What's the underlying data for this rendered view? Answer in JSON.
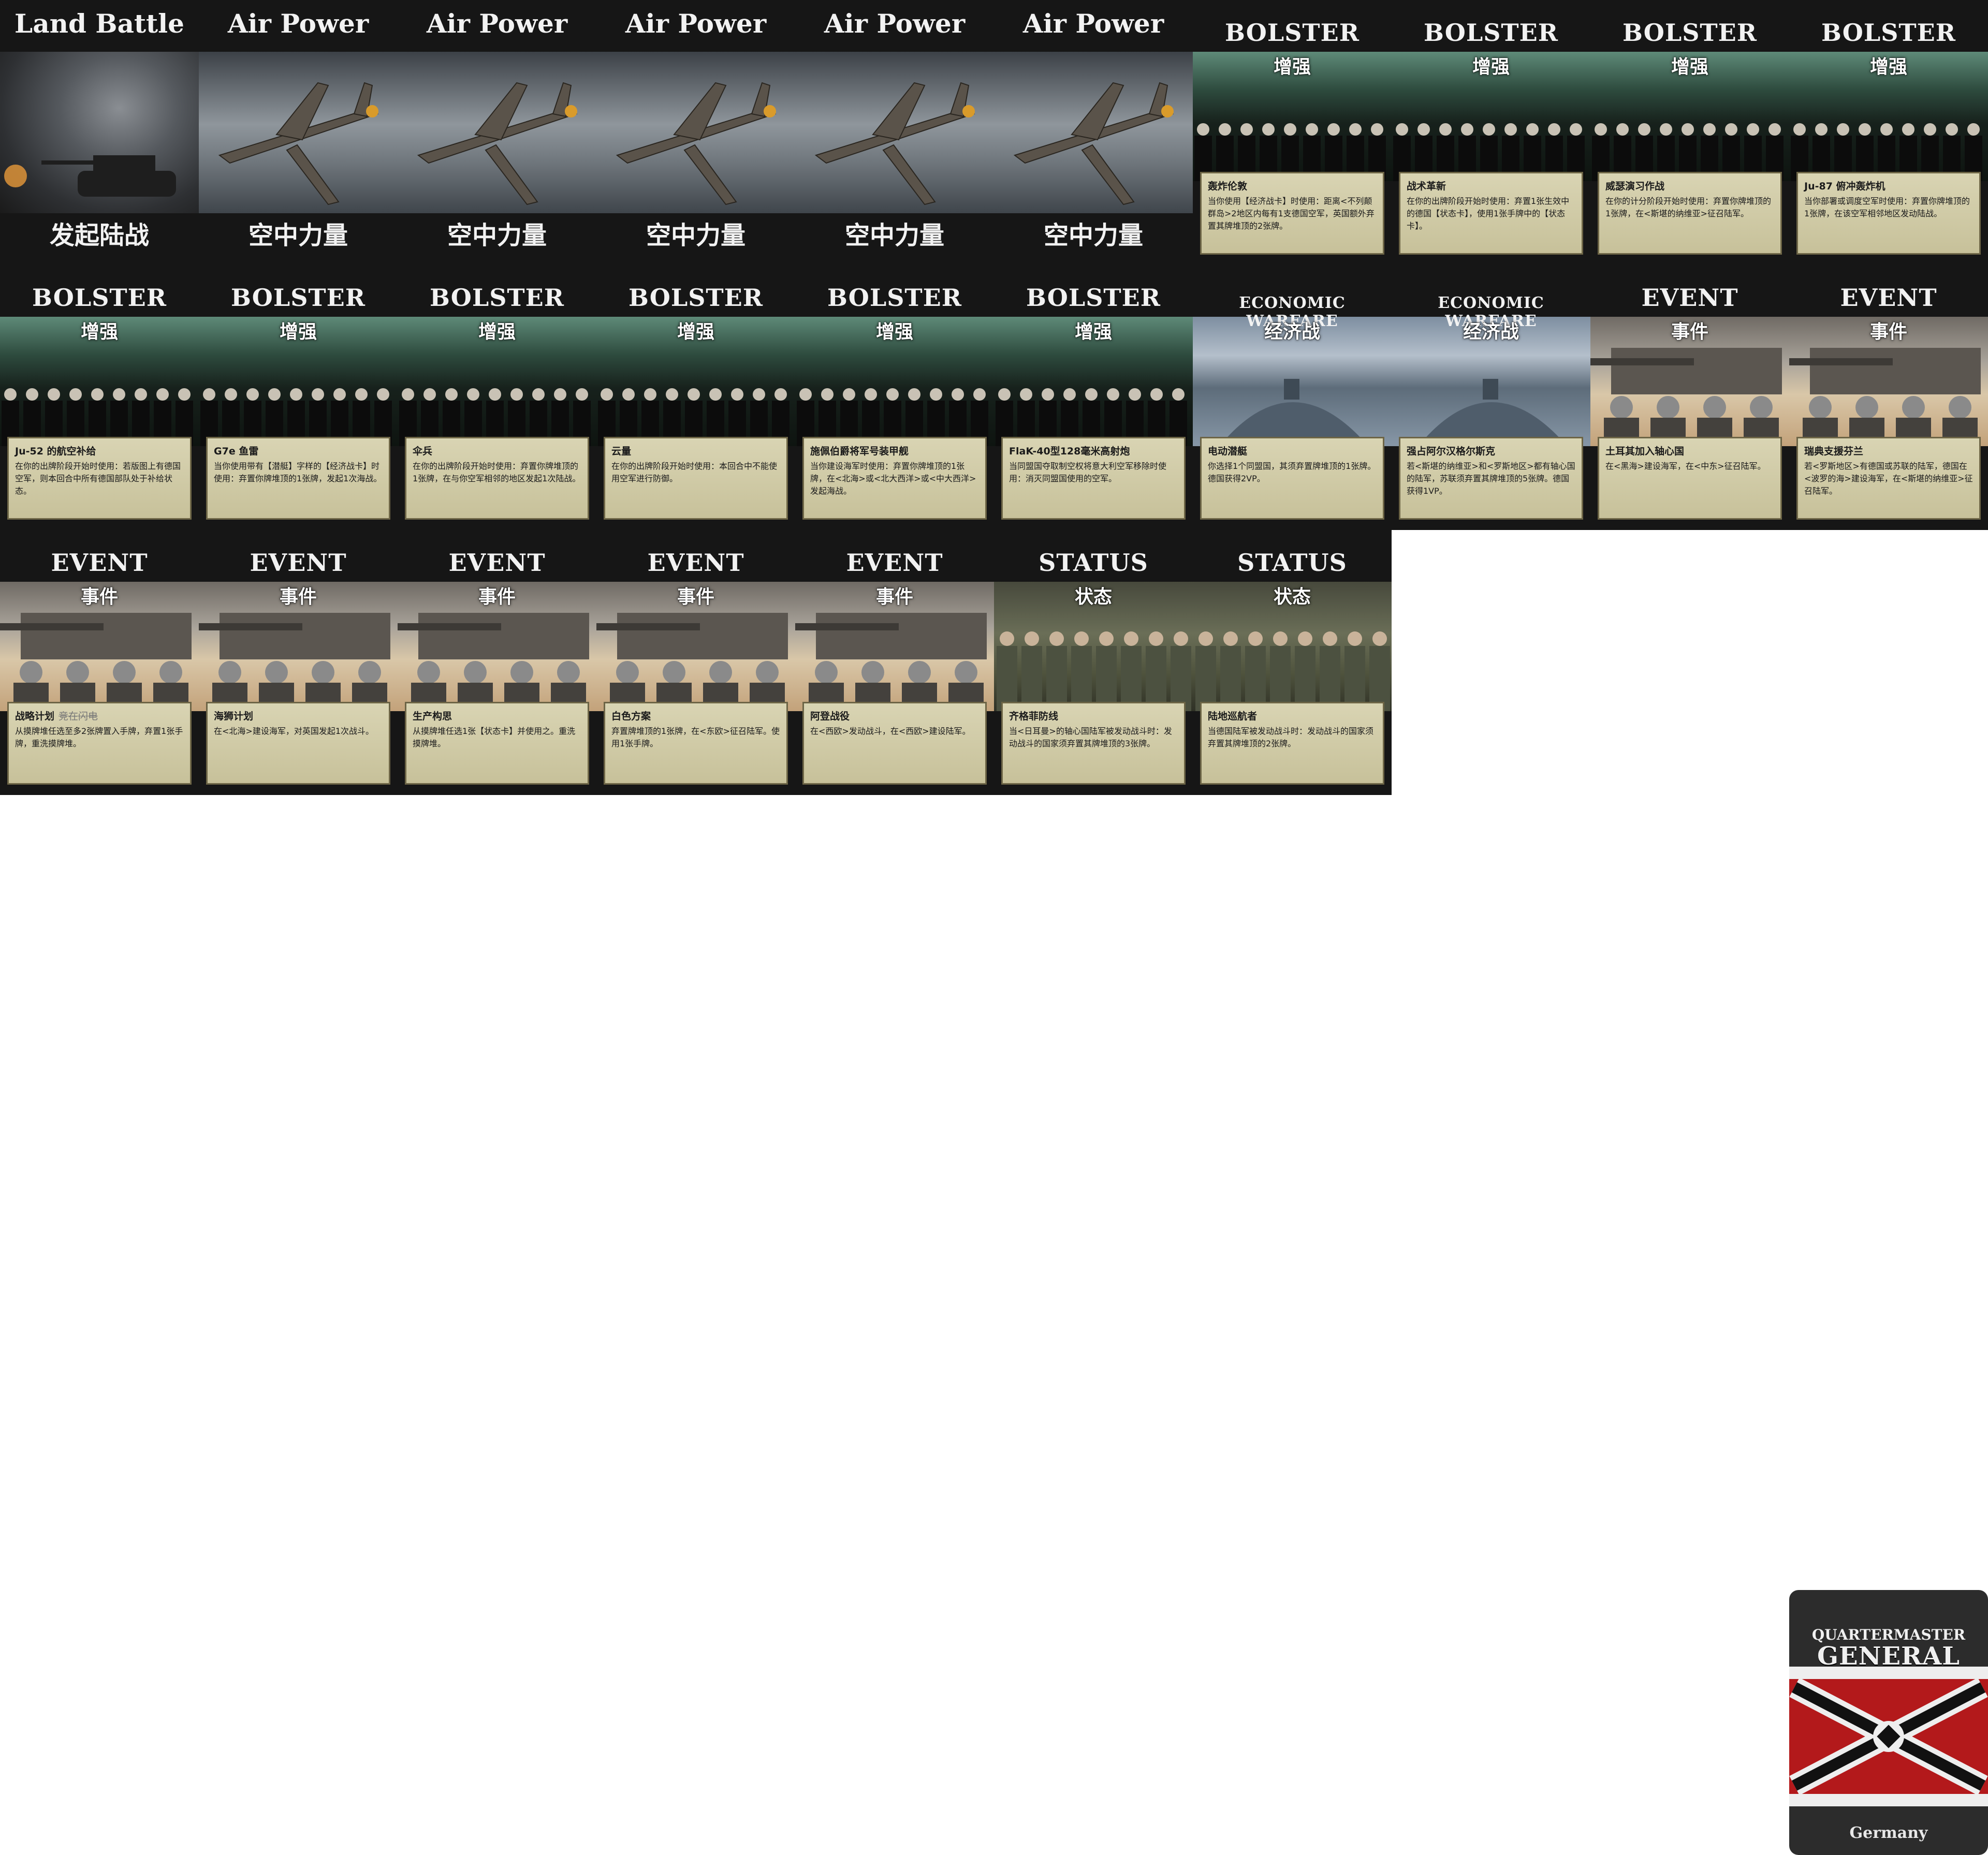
{
  "power_cards": [
    {
      "title_en": "Land Battle",
      "title_zh": "发起陆战",
      "art": "tank-icon"
    },
    {
      "title_en": "Air Power",
      "title_zh": "空中力量",
      "art": "fighter-plane-icon"
    },
    {
      "title_en": "Air Power",
      "title_zh": "空中力量",
      "art": "fighter-plane-icon"
    },
    {
      "title_en": "Air Power",
      "title_zh": "空中力量",
      "art": "fighter-plane-icon"
    },
    {
      "title_en": "Air Power",
      "title_zh": "空中力量",
      "art": "fighter-plane-icon"
    },
    {
      "title_en": "Air Power",
      "title_zh": "空中力量",
      "art": "fighter-plane-icon"
    }
  ],
  "rule_cards": [
    {
      "category_en": "BOLSTER",
      "category_zh": "增强",
      "name": "轰炸伦敦",
      "strike": "",
      "text": "当你使用【经济战卡】时使用：距离<不列颠群岛>2地区内每有1支德国空军，英国额外弃置其牌堆顶的2张牌。",
      "art": "bolster"
    },
    {
      "category_en": "BOLSTER",
      "category_zh": "增强",
      "name": "战术革新",
      "strike": "",
      "text": "在你的出牌阶段开始时使用：弃置1张生效中的德国【状态卡】，使用1张手牌中的【状态卡】。",
      "art": "bolster"
    },
    {
      "category_en": "BOLSTER",
      "category_zh": "增强",
      "name": "威瑟演习作战",
      "strike": "",
      "text": "在你的计分阶段开始时使用：弃置你牌堆顶的1张牌，在<斯堪的纳维亚>征召陆军。",
      "art": "bolster"
    },
    {
      "category_en": "BOLSTER",
      "category_zh": "增强",
      "name": "Ju-87 俯冲轰炸机",
      "strike": "",
      "text": "当你部署或调度空军时使用：弃置你牌堆顶的1张牌，在该空军相邻地区发动陆战。",
      "art": "bolster"
    },
    {
      "category_en": "BOLSTER",
      "category_zh": "增强",
      "name": "Ju-52 的航空补给",
      "strike": "",
      "text": "在你的出牌阶段开始时使用：若版图上有德国空军，则本回合中所有德国部队处于补给状态。",
      "art": "bolster"
    },
    {
      "category_en": "BOLSTER",
      "category_zh": "增强",
      "name": "G7e 鱼雷",
      "strike": "",
      "text": "当你使用带有【潜艇】字样的【经济战卡】时使用：弃置你牌堆顶的1张牌，发起1次海战。",
      "art": "bolster"
    },
    {
      "category_en": "BOLSTER",
      "category_zh": "增强",
      "name": "伞兵",
      "strike": "",
      "text": "在你的出牌阶段开始时使用：弃置你牌堆顶的1张牌，在与你空军相邻的地区发起1次陆战。",
      "art": "bolster"
    },
    {
      "category_en": "BOLSTER",
      "category_zh": "增强",
      "name": "云量",
      "strike": "",
      "text": "在你的出牌阶段开始时使用：本回合中不能使用空军进行防御。",
      "art": "bolster"
    },
    {
      "category_en": "BOLSTER",
      "category_zh": "增强",
      "name": "施佩伯爵将军号装甲舰",
      "strike": "",
      "text": "当你建设海军时使用：弃置你牌堆顶的1张牌，在<北海>或<北大西洋>或<中大西洋>发起海战。",
      "art": "bolster"
    },
    {
      "category_en": "BOLSTER",
      "category_zh": "增强",
      "name": "FlaK-40型128毫米高射炮",
      "strike": "",
      "text": "当同盟国夺取制空权将意大利空军移除时使用：消灭同盟国使用的空军。",
      "art": "bolster"
    },
    {
      "category_en": "ECONOMIC WARFARE",
      "category_zh": "经济战",
      "name": "电动潜艇",
      "strike": "",
      "text": "你选择1个同盟国，其须弃置牌堆顶的1张牌。德国获得2VP。",
      "art": "econ"
    },
    {
      "category_en": "ECONOMIC WARFARE",
      "category_zh": "经济战",
      "name": "强占阿尔汉格尔斯克",
      "strike": "",
      "text": "若<斯堪的纳维亚>和<罗斯地区>都有轴心国的陆军，苏联须弃置其牌堆顶的5张牌。德国获得1VP。",
      "art": "econ"
    },
    {
      "category_en": "EVENT",
      "category_zh": "事件",
      "name": "土耳其加入轴心国",
      "strike": "",
      "text": "在<黑海>建设海军，在<中东>征召陆军。",
      "art": "event"
    },
    {
      "category_en": "EVENT",
      "category_zh": "事件",
      "name": "瑞典支援芬兰",
      "strike": "",
      "text": "若<罗斯地区>有德国或苏联的陆军，德国在<波罗的海>建设海军，在<斯堪的纳维亚>征召陆军。",
      "art": "event"
    },
    {
      "category_en": "EVENT",
      "category_zh": "事件",
      "name": "战略计划",
      "strike": "竞在闪电",
      "text": "从摸牌堆任选至多2张牌置入手牌，弃置1张手牌，重洗摸牌堆。",
      "art": "event"
    },
    {
      "category_en": "EVENT",
      "category_zh": "事件",
      "name": "海狮计划",
      "strike": "",
      "text": "在<北海>建设海军，对英国发起1次战斗。",
      "art": "event"
    },
    {
      "category_en": "EVENT",
      "category_zh": "事件",
      "name": "生产构思",
      "strike": "",
      "text": "从摸牌堆任选1张【状态卡】并使用之。重洗摸牌堆。",
      "art": "event"
    },
    {
      "category_en": "EVENT",
      "category_zh": "事件",
      "name": "白色方案",
      "strike": "",
      "text": "弃置牌堆顶的1张牌，在<东欧>征召陆军。使用1张手牌。",
      "art": "event"
    },
    {
      "category_en": "EVENT",
      "category_zh": "事件",
      "name": "阿登战役",
      "strike": "",
      "text": "在<西欧>发动战斗，在<西欧>建设陆军。",
      "art": "event"
    },
    {
      "category_en": "STATUS",
      "category_zh": "状态",
      "name": "齐格菲防线",
      "strike": "",
      "text": "当<日耳曼>的轴心国陆军被发动战斗时：发动战斗的国家须弃置其牌堆顶的3张牌。",
      "art": "status"
    },
    {
      "category_en": "STATUS",
      "category_zh": "状态",
      "name": "陆地巡航者",
      "strike": "",
      "text": "当德国陆军被发动战斗时：发动战斗的国家须弃置其牌堆顶的2张牌。",
      "art": "status"
    }
  ],
  "card_back": {
    "logo_top": "QUARTERMASTER",
    "logo_main": "GENERAL",
    "country": "Germany",
    "flag_colors": {
      "black": "#111111",
      "white": "#eeeeee",
      "red": "#b3191b"
    }
  }
}
